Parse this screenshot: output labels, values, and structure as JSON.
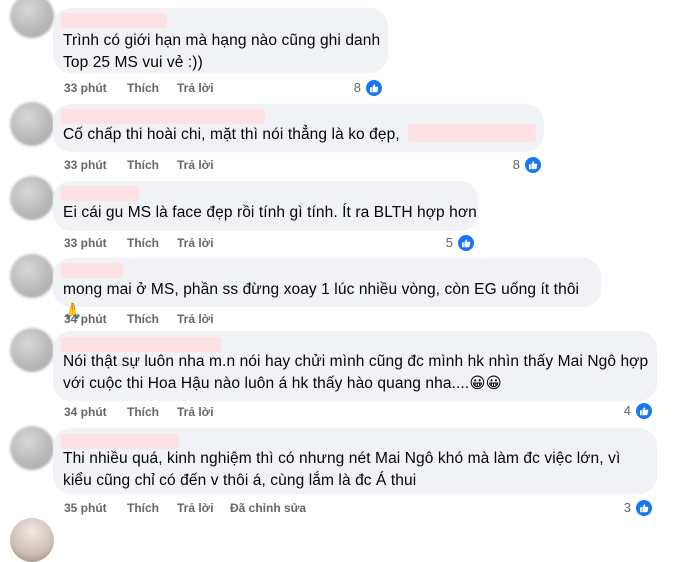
{
  "comments": [
    {
      "lines": [
        "Trình có giới hạn mà hạng nào cũng ghi danh",
        "Top 25 MS vui vẻ :))"
      ],
      "time": "33 phút",
      "like": "Thích",
      "reply": "Trả lời",
      "likes": "8"
    },
    {
      "lines": [
        "Cố chấp thi hoài chi, mặt thì nói thẳng là ko đẹp,"
      ],
      "time": "33 phút",
      "like": "Thích",
      "reply": "Trả lời",
      "likes": "8"
    },
    {
      "lines": [
        "Ei cái gu MS là face đẹp rồi tính gì tính. Ít ra BLTH hợp hơn"
      ],
      "time": "33 phút",
      "like": "Thích",
      "reply": "Trả lời",
      "likes": "5"
    },
    {
      "lines": [
        "mong mai ở MS, phần ss đừng xoay 1 lúc nhiều vòng, còn EG uống ít thôi 🙏"
      ],
      "time": "34 phút",
      "like": "Thích",
      "reply": "Trả lời",
      "likes": ""
    },
    {
      "lines": [
        "Nói thật sự luôn nha m.n nói hay chửi mình cũng đc mình hk nhìn thấy Mai Ngô hợp",
        "với cuộc thi Hoa Hậu nào luôn á hk thấy hào quang nha....😀😀"
      ],
      "time": "34 phút",
      "like": "Thích",
      "reply": "Trả lời",
      "likes": "4"
    },
    {
      "lines": [
        "Thi nhiều quá, kinh nghiệm thì có nhưng nét Mai Ngô khó mà làm đc việc lớn, vì",
        "kiểu cũng chỉ có đến v thôi á, cùng lắm là đc Á thui"
      ],
      "time": "35 phút",
      "like": "Thích",
      "reply": "Trả lời",
      "edited": "Đã chỉnh sửa",
      "likes": "3"
    }
  ]
}
